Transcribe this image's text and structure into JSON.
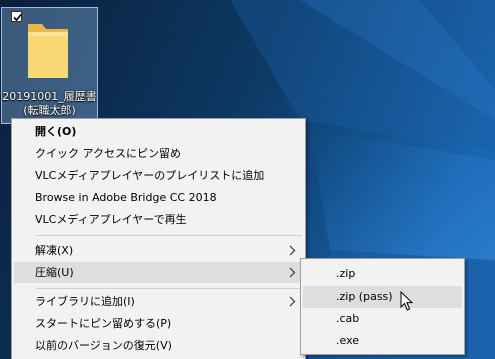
{
  "desktop": {
    "folder": {
      "name_line1": "20191001_履歴書",
      "name_line2": "(転職太郎)",
      "icon": "folder-icon"
    }
  },
  "context_menu": {
    "items": [
      {
        "label": "開く(O)"
      },
      {
        "label": "クイック アクセスにピン留め"
      },
      {
        "label": "VLCメディアプレイヤーのプレイリストに追加"
      },
      {
        "label": "Browse in Adobe Bridge CC 2018"
      },
      {
        "label": "VLCメディアプレイヤーで再生"
      },
      {
        "label": "解凍(X)"
      },
      {
        "label": "圧縮(U)"
      },
      {
        "label": "ライブラリに追加(I)"
      },
      {
        "label": "スタートにピン留めする(P)"
      },
      {
        "label": "以前のバージョンの復元(V)"
      }
    ]
  },
  "submenu": {
    "items": [
      {
        "label": ".zip"
      },
      {
        "label": ".zip (pass)"
      },
      {
        "label": ".cab"
      },
      {
        "label": ".exe"
      }
    ]
  },
  "colors": {
    "menu_bg": "#f2f2f2",
    "hover_bg": "#dedede",
    "separator": "#cfcfcf"
  }
}
